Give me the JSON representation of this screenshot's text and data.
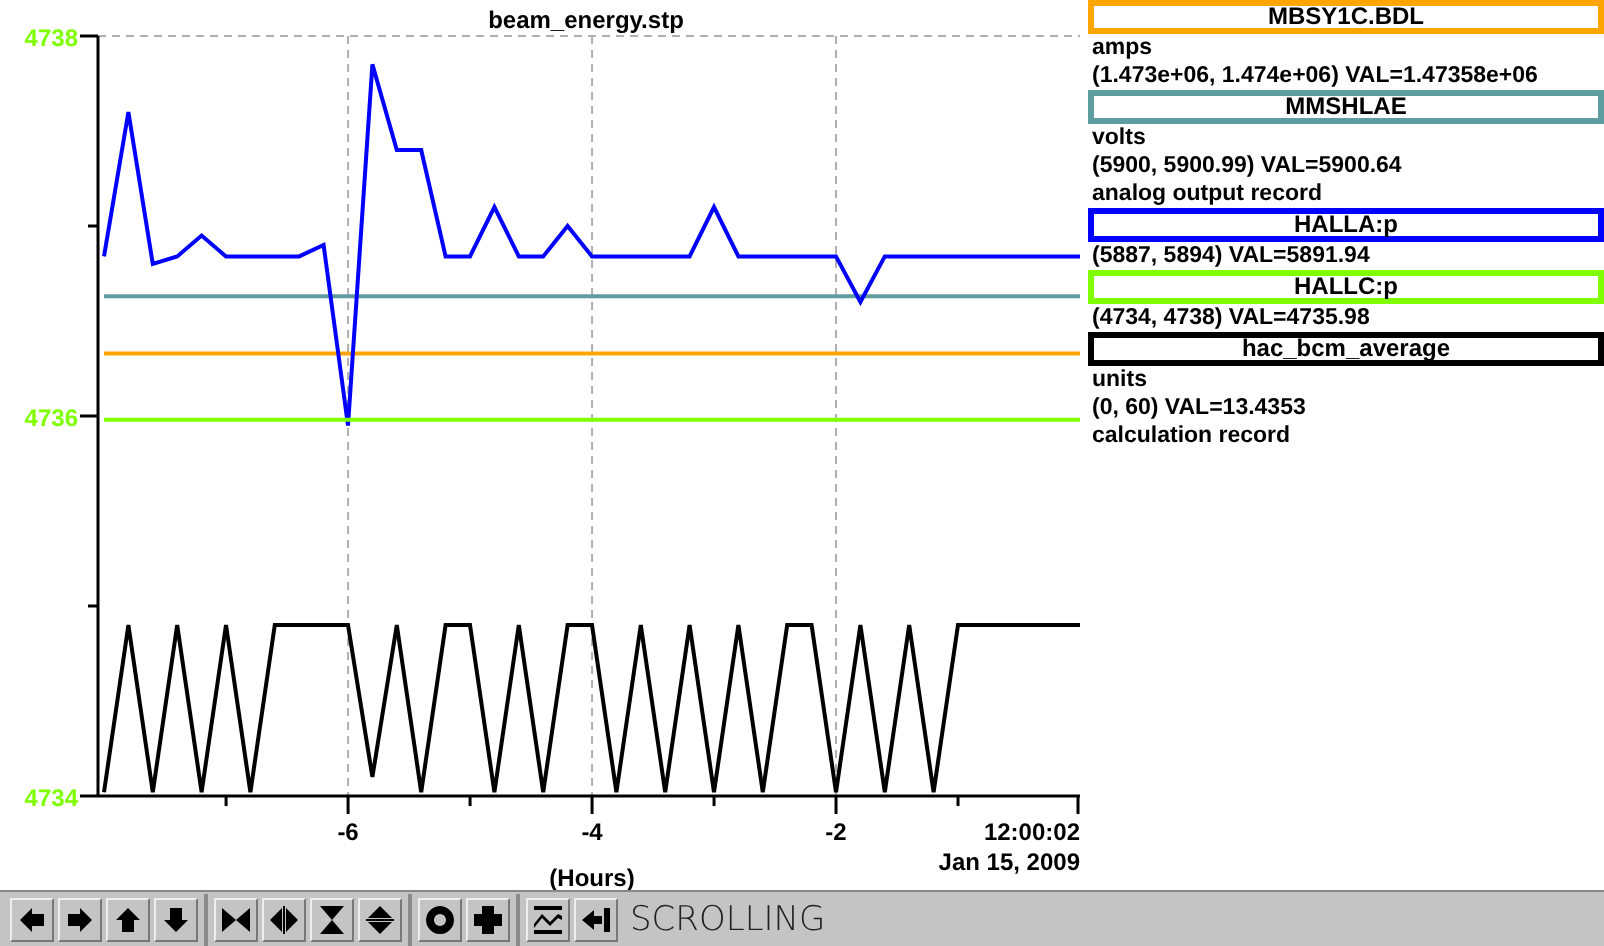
{
  "chart": {
    "chart_data": {
      "type": "line",
      "title": "beam_energy.stp",
      "xlabel": "(Hours)",
      "x": [
        -8,
        -7.8,
        -7.6,
        -7.4,
        -7.2,
        -7,
        -6.8,
        -6.6,
        -6.4,
        -6.2,
        -6,
        -5.8,
        -5.6,
        -5.4,
        -5.2,
        -5,
        -4.8,
        -4.6,
        -4.4,
        -4.2,
        -4,
        -3.8,
        -3.6,
        -3.4,
        -3.2,
        -3,
        -2.8,
        -2.6,
        -2.4,
        -2.2,
        -2,
        -1.8,
        -1.6,
        -1.4,
        -1.2,
        -1,
        -0.8,
        -0.6,
        -0.4,
        -0.2,
        0
      ],
      "series": [
        {
          "name": "MBSY1C.BDL",
          "color": "#ffa500",
          "values": [
            4736.33,
            4736.33,
            4736.33,
            4736.33,
            4736.33,
            4736.33,
            4736.33,
            4736.33,
            4736.33,
            4736.33,
            4736.33,
            4736.33,
            4736.33,
            4736.33,
            4736.33,
            4736.33,
            4736.33,
            4736.33,
            4736.33,
            4736.33,
            4736.33,
            4736.33,
            4736.33,
            4736.33,
            4736.33,
            4736.33,
            4736.33,
            4736.33,
            4736.33,
            4736.33,
            4736.33,
            4736.33,
            4736.33,
            4736.33,
            4736.33,
            4736.33,
            4736.33,
            4736.33,
            4736.33,
            4736.33,
            4736.33
          ]
        },
        {
          "name": "MMSHLAE",
          "color": "#5f9ea0",
          "values": [
            4736.63,
            4736.63,
            4736.63,
            4736.63,
            4736.63,
            4736.63,
            4736.63,
            4736.63,
            4736.63,
            4736.63,
            4736.63,
            4736.63,
            4736.63,
            4736.63,
            4736.63,
            4736.63,
            4736.63,
            4736.63,
            4736.63,
            4736.63,
            4736.63,
            4736.63,
            4736.63,
            4736.63,
            4736.63,
            4736.63,
            4736.63,
            4736.63,
            4736.63,
            4736.63,
            4736.63,
            4736.63,
            4736.63,
            4736.63,
            4736.63,
            4736.63,
            4736.63,
            4736.63,
            4736.63,
            4736.63,
            4736.63
          ]
        },
        {
          "name": "HALLA:p",
          "color": "#0000ff",
          "values": [
            4736.84,
            4737.6,
            4736.8,
            4736.84,
            4736.95,
            4736.84,
            4736.84,
            4736.84,
            4736.84,
            4736.9,
            4735.95,
            4737.85,
            4737.4,
            4737.4,
            4736.84,
            4736.84,
            4737.1,
            4736.84,
            4736.84,
            4737.0,
            4736.84,
            4736.84,
            4736.84,
            4736.84,
            4736.84,
            4737.1,
            4736.84,
            4736.84,
            4736.84,
            4736.84,
            4736.84,
            4736.6,
            4736.84,
            4736.84,
            4736.84,
            4736.84,
            4736.84,
            4736.84,
            4736.84,
            4736.84,
            4736.84
          ]
        },
        {
          "name": "HALLC:p",
          "color": "#7fff00",
          "values": [
            4735.98,
            4735.98,
            4735.98,
            4735.98,
            4735.98,
            4735.98,
            4735.98,
            4735.98,
            4735.98,
            4735.98,
            4735.98,
            4735.98,
            4735.98,
            4735.98,
            4735.98,
            4735.98,
            4735.98,
            4735.98,
            4735.98,
            4735.98,
            4735.98,
            4735.98,
            4735.98,
            4735.98,
            4735.98,
            4735.98,
            4735.98,
            4735.98,
            4735.98,
            4735.98,
            4735.98,
            4735.98,
            4735.98,
            4735.98,
            4735.98,
            4735.98,
            4735.98,
            4735.98,
            4735.98,
            4735.98,
            4735.98
          ]
        },
        {
          "name": "hac_bcm_average",
          "color": "#000000",
          "values": [
            4734.02,
            4734.9,
            4734.02,
            4734.9,
            4734.02,
            4734.9,
            4734.02,
            4734.9,
            4734.9,
            4734.9,
            4734.9,
            4734.1,
            4734.9,
            4734.02,
            4734.9,
            4734.9,
            4734.02,
            4734.9,
            4734.02,
            4734.9,
            4734.9,
            4734.02,
            4734.9,
            4734.02,
            4734.9,
            4734.02,
            4734.9,
            4734.02,
            4734.9,
            4734.9,
            4734.02,
            4734.9,
            4734.02,
            4734.9,
            4734.02,
            4734.9,
            4734.9,
            4734.9,
            4734.9,
            4734.9,
            4734.9
          ]
        }
      ],
      "xlim": [
        -8.05,
        0
      ],
      "ylim": [
        4734,
        4738
      ],
      "grid": true,
      "xticks": [
        -6,
        -4,
        -2
      ],
      "yticks": [
        {
          "value": 4734,
          "label": "4734"
        },
        {
          "value": 4736,
          "label": "4736"
        },
        {
          "value": 4738,
          "label": "4738"
        }
      ]
    },
    "end_time": "12:00:02",
    "date": "Jan 15, 2009"
  },
  "legend": [
    {
      "lines": [
        "amps",
        "(1.473e+06, 1.474e+06)  VAL=1.47358e+06"
      ]
    },
    {
      "lines": [
        "volts",
        "(5900, 5900.99) VAL=5900.64",
        "analog output record"
      ]
    },
    {
      "lines": [
        "(5887, 5894) VAL=5891.94"
      ]
    },
    {
      "lines": [
        "(4734, 4738) VAL=4735.98"
      ]
    },
    {
      "lines": [
        "units",
        "(0, 60) VAL=13.4353",
        "calculation record"
      ]
    }
  ],
  "toolbar": {
    "groups": [
      [
        {
          "kind": "left"
        },
        {
          "kind": "right"
        },
        {
          "kind": "up"
        },
        {
          "kind": "down"
        }
      ],
      [
        {
          "kind": "zoom-in-h"
        },
        {
          "kind": "zoom-out-h"
        },
        {
          "kind": "zoom-in-v"
        },
        {
          "kind": "zoom-out-v"
        }
      ],
      [
        {
          "kind": "auto"
        },
        {
          "kind": "plus"
        }
      ],
      [
        {
          "kind": "graph"
        },
        {
          "kind": "back"
        }
      ]
    ],
    "status": "SCROLLING"
  }
}
